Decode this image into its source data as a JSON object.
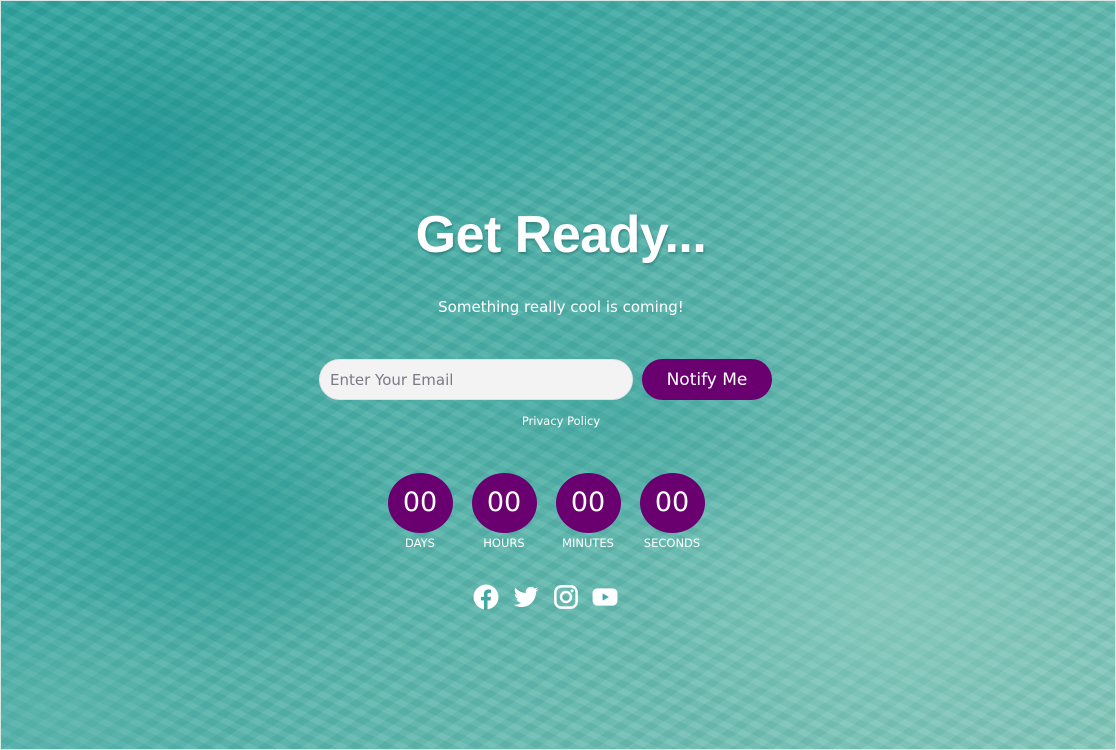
{
  "hero": {
    "title": "Get Ready...",
    "subtitle": "Something really cool is coming!"
  },
  "signup": {
    "email_placeholder": "Enter Your Email",
    "email_value": "",
    "submit_label": "Notify Me",
    "privacy_label": "Privacy Policy"
  },
  "countdown": {
    "units": [
      {
        "value": "00",
        "label": "DAYS"
      },
      {
        "value": "00",
        "label": "HOURS"
      },
      {
        "value": "00",
        "label": "MINUTES"
      },
      {
        "value": "00",
        "label": "SECONDS"
      }
    ]
  },
  "social": {
    "icons": [
      "facebook-icon",
      "twitter-icon",
      "instagram-icon",
      "youtube-icon"
    ]
  },
  "colors": {
    "accent": "#6a006f",
    "background": "#4fb0a8",
    "text": "#ffffff",
    "input_background": "#f3f3f3"
  }
}
